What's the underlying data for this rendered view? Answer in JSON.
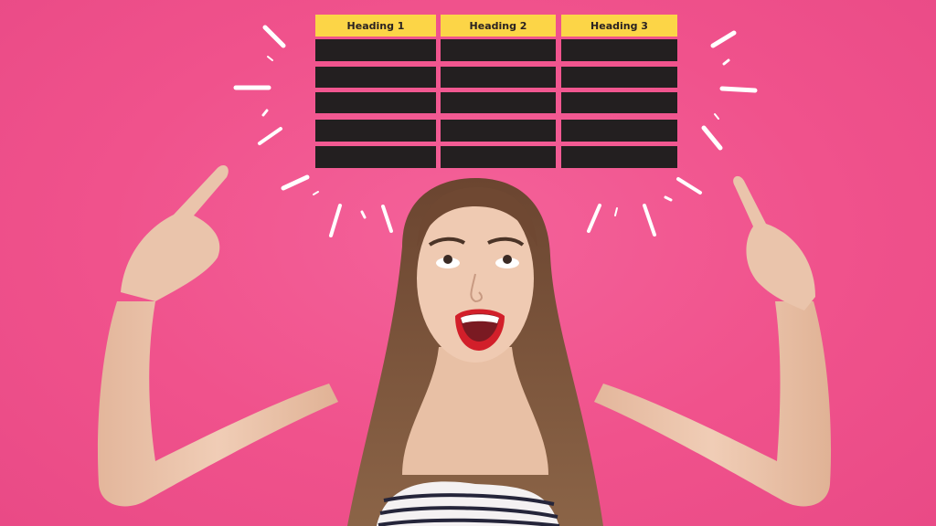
{
  "image": {
    "description": "Excited woman with long brown hair and red lipstick looking up and pointing with both index fingers at a table graphic on a pink background",
    "colors": {
      "background": "#f0528c",
      "header_fill": "#fcd547",
      "cell_fill": "#231f20",
      "burst_marks": "#ffffff",
      "skin": "#e9c0a6",
      "hair": "#7a5339",
      "lips": "#d21f2a"
    }
  },
  "table": {
    "headers": [
      "Heading 1",
      "Heading 2",
      "Heading 3"
    ],
    "row_count": 5,
    "rows": [
      [
        "",
        "",
        ""
      ],
      [
        "",
        "",
        ""
      ],
      [
        "",
        "",
        ""
      ],
      [
        "",
        "",
        ""
      ],
      [
        "",
        "",
        ""
      ]
    ]
  }
}
